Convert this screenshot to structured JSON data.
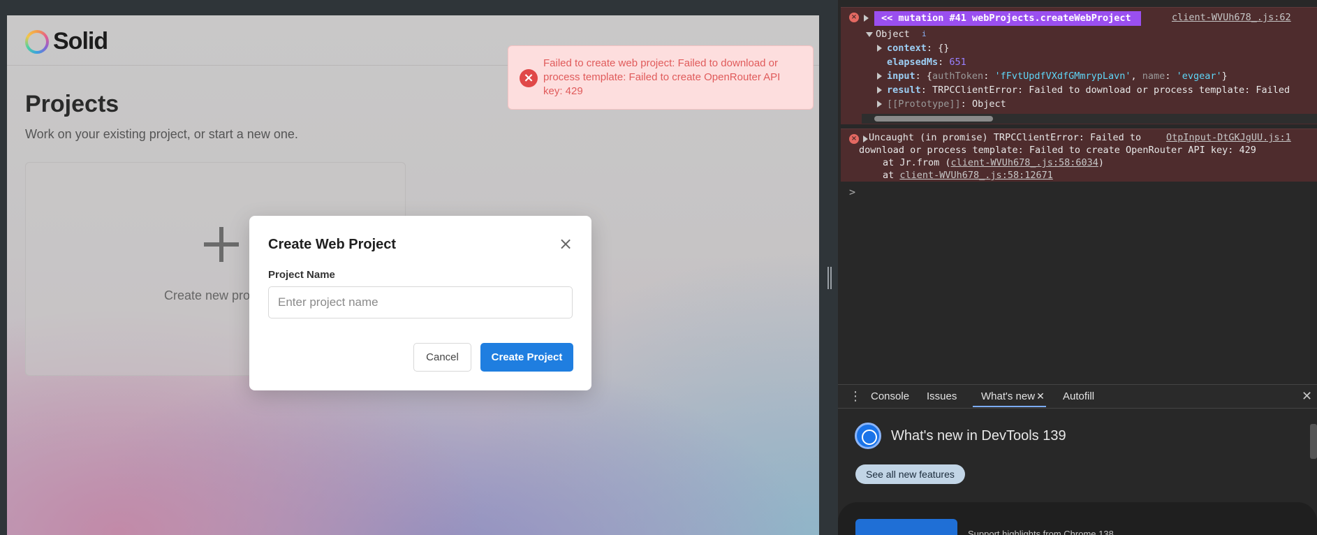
{
  "app": {
    "logo_text": "Solid",
    "title": "Projects",
    "subtitle": "Work on your existing project, or start a new one.",
    "new_card_label": "Create new pro"
  },
  "toast": {
    "message": "Failed to create web project: Failed to download or process template: Failed to create OpenRouter API key: 429",
    "icon": "error-x-icon"
  },
  "modal": {
    "title": "Create Web Project",
    "field_label": "Project Name",
    "field_value": "",
    "field_placeholder": "Enter project name",
    "cancel_label": "Cancel",
    "create_label": "Create Project"
  },
  "devtools": {
    "err1": {
      "badge": "<< mutation #41  webProjects.createWebProject",
      "source": "client-WVUh678_.js:62",
      "object_label": "Object",
      "info_badge": "i",
      "lines": [
        {
          "key": "context",
          "value": "{}"
        },
        {
          "key": "elapsedMs",
          "value": "651"
        },
        {
          "key": "input",
          "k1": "authToken",
          "v1": "'fFvtUpdfVXdfGMmrypLavn'",
          "k2": "name",
          "v2": "'evgear'"
        },
        {
          "key": "result",
          "value": "TRPCClientError: Failed to download or process template: Failed"
        },
        {
          "key": "[[Prototype]]",
          "value": "Object"
        }
      ]
    },
    "err2": {
      "line1": "Uncaught (in promise) TRPCClientError: Failed to",
      "source": "OtpInput-DtGKJgUU.js:1",
      "line2": "download or process template: Failed to create OpenRouter API key: 429",
      "at1_prefix": "at Jr.from (",
      "at1_link": "client-WVUh678_.js:58:6034",
      "at1_suffix": ")",
      "at2_prefix": "at ",
      "at2_link": "client-WVUh678_.js:58:12671"
    },
    "prompt": ">",
    "drawer": {
      "tabs": [
        "Console",
        "Issues",
        "What's new",
        "Autofill"
      ],
      "active_tab": "What's new",
      "whats_new_title": "What's new in DevTools 139",
      "see_all": "See all new features",
      "card_text": "Support highlights from Chrome 138"
    }
  }
}
